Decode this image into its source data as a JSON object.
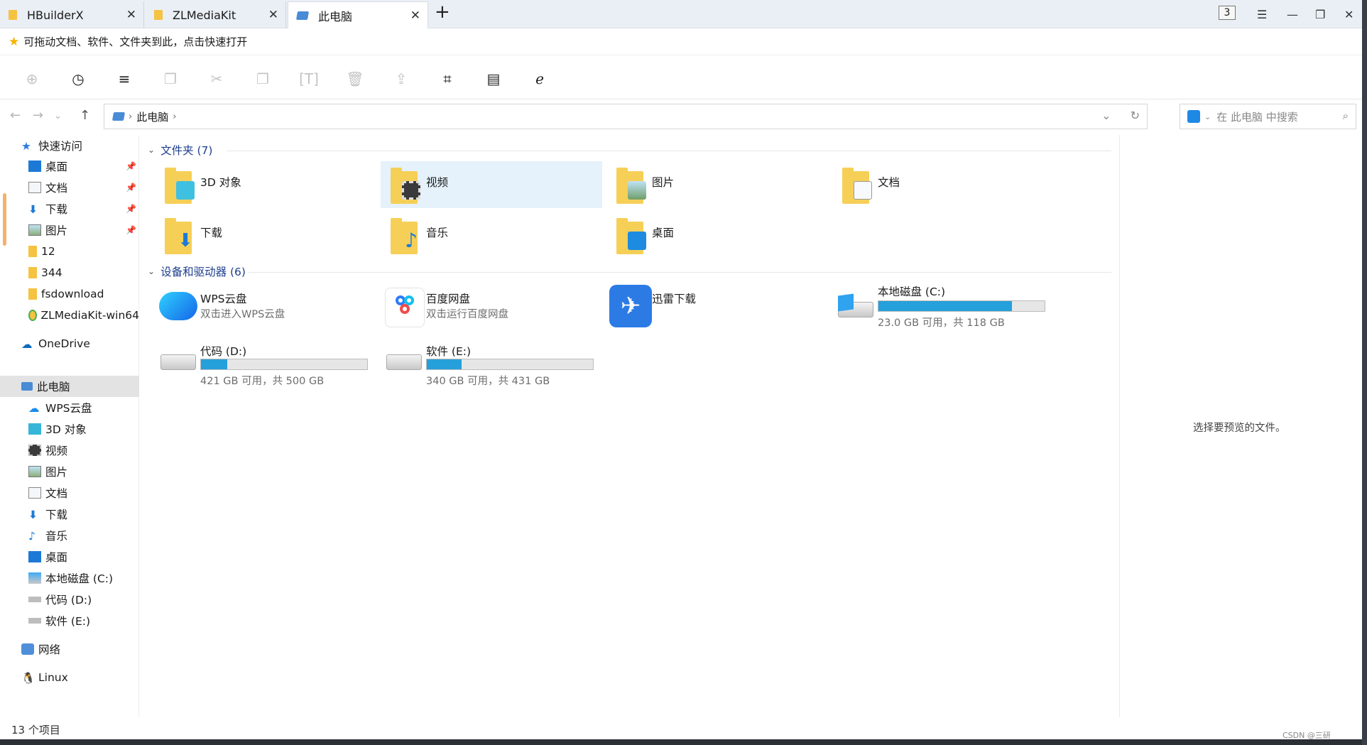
{
  "tabs": [
    {
      "label": "HBuilderX"
    },
    {
      "label": "ZLMediaKit"
    },
    {
      "label": "此电脑"
    }
  ],
  "window": {
    "tab_count": "3"
  },
  "hint": {
    "text": "可拖动文档、软件、文件夹到此，点击快速打开"
  },
  "address": {
    "location": "此电脑"
  },
  "search": {
    "placeholder": "在 此电脑 中搜索"
  },
  "sidebar": {
    "quick_access": "快速访问",
    "quick_items": [
      "桌面",
      "文档",
      "下载",
      "图片",
      "12",
      "344",
      "fsdownload",
      "ZLMediaKit-win64"
    ],
    "onedrive": "OneDrive",
    "this_pc": "此电脑",
    "pc_items": [
      "WPS云盘",
      "3D 对象",
      "视频",
      "图片",
      "文档",
      "下载",
      "音乐",
      "桌面",
      "本地磁盘 (C:)",
      "代码 (D:)",
      "软件 (E:)"
    ],
    "network": "网络",
    "linux": "Linux"
  },
  "folders_section": {
    "title": "文件夹 (7)"
  },
  "folders": [
    "3D 对象",
    "视频",
    "图片",
    "文档",
    "下载",
    "音乐",
    "桌面"
  ],
  "devices_section": {
    "title": "设备和驱动器 (6)"
  },
  "devices": {
    "wps": {
      "name": "WPS云盘",
      "sub": "双击进入WPS云盘"
    },
    "baidu": {
      "name": "百度网盘",
      "sub": "双击运行百度网盘"
    },
    "xunlei": {
      "name": "迅雷下载"
    },
    "c": {
      "name": "本地磁盘 (C:)",
      "sub": "23.0 GB 可用，共 118 GB",
      "used_fraction": 0.805
    },
    "d": {
      "name": "代码 (D:)",
      "sub": "421 GB 可用，共 500 GB",
      "used_fraction": 0.158
    },
    "e": {
      "name": "软件 (E:)",
      "sub": "340 GB 可用，共 431 GB",
      "used_fraction": 0.211
    }
  },
  "preview": {
    "text": "选择要预览的文件。"
  },
  "status": {
    "text": "13 个项目"
  },
  "watermark": {
    "text": "CSDN @三研"
  }
}
